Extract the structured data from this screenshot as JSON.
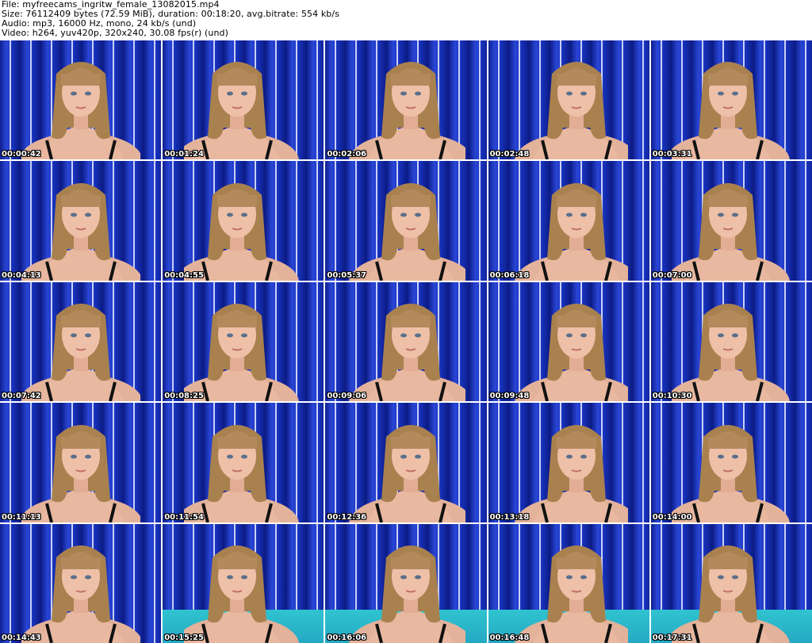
{
  "header": {
    "file_line": "File: myfreecams_ingritw_female_13082015.mp4",
    "size_line": "Size: 76112409 bytes (72.59 MiB), duration: 00:18:20, avg.bitrate: 554 kb/s",
    "audio_line": "Audio: mp3, 16000 Hz, mono, 24 kb/s (und)",
    "video_line": "Video: h264, yuv420p, 320x240, 30.08 fps(r) (und)"
  },
  "thumbnails": [
    {
      "time": "00:00:42"
    },
    {
      "time": "00:01:24"
    },
    {
      "time": "00:02:06"
    },
    {
      "time": "00:02:48"
    },
    {
      "time": "00:03:31"
    },
    {
      "time": "00:04:13"
    },
    {
      "time": "00:04:55"
    },
    {
      "time": "00:05:37"
    },
    {
      "time": "00:06:18"
    },
    {
      "time": "00:07:00"
    },
    {
      "time": "00:07:42"
    },
    {
      "time": "00:08:25"
    },
    {
      "time": "00:09:06"
    },
    {
      "time": "00:09:48"
    },
    {
      "time": "00:10:30"
    },
    {
      "time": "00:11:13"
    },
    {
      "time": "00:11:54"
    },
    {
      "time": "00:12:36"
    },
    {
      "time": "00:13:18"
    },
    {
      "time": "00:14:00"
    },
    {
      "time": "00:14:43"
    },
    {
      "time": "00:15:25"
    },
    {
      "time": "00:16:06"
    },
    {
      "time": "00:16:48"
    },
    {
      "time": "00:17:31"
    }
  ],
  "colors": {
    "page_background": "#ffffff",
    "header_text": "#000000",
    "curtain_blue": "#1a2fb0",
    "timestamp_text": "#ffffff",
    "hair": "#b38a5c",
    "skin": "#e8b8a0",
    "strap": "#111111"
  }
}
